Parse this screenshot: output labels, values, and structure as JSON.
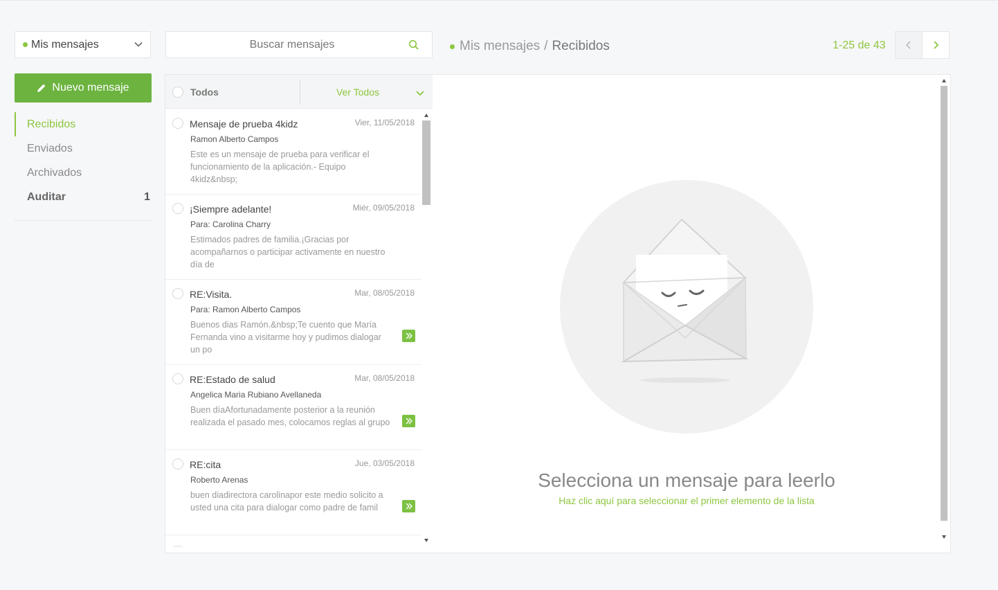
{
  "mailbox_select": {
    "label": "Mis mensajes"
  },
  "new_message": {
    "label": "Nuevo mensaje"
  },
  "folders": [
    {
      "label": "Recibidos",
      "count": ""
    },
    {
      "label": "Enviados",
      "count": ""
    },
    {
      "label": "Archivados",
      "count": ""
    },
    {
      "label": "Auditar",
      "count": "1"
    }
  ],
  "search": {
    "placeholder": "Buscar mensajes"
  },
  "breadcrumb": {
    "root": "Mis mensajes",
    "separator": "/",
    "current": "Recibidos"
  },
  "pagination": {
    "text": "1-25 de 43"
  },
  "list_header": {
    "select_all": "Todos",
    "filter": "Ver Todos"
  },
  "messages": [
    {
      "subject": "Mensaje de prueba 4kidz",
      "date": "Vier, 11/05/2018",
      "from": "Ramon Alberto Campos",
      "preview": "Este es un mensaje de prueba para verificar el funcionamiento de la aplicación.- Equipo 4kidz&nbsp;",
      "forwarded": false
    },
    {
      "subject": "¡Siempre adelante!",
      "date": "Miér, 09/05/2018",
      "from": "Para: Carolina Charry",
      "preview": "Estimados padres de familia.¡Gracias por acompañarnos o participar activamente en nuestro día de",
      "forwarded": false
    },
    {
      "subject": "RE:Visita.",
      "date": "Mar, 08/05/2018",
      "from": "Para: Ramon Alberto Campos",
      "preview": "Buenos dias Ramón.&nbsp;Te cuento que María Fernanda vino a visitarme hoy y pudimos dialogar un po",
      "forwarded": true
    },
    {
      "subject": "RE:Estado de salud",
      "date": "Mar, 08/05/2018",
      "from": "Angelica Maria Rubiano Avellaneda",
      "preview": "Buen díaAfortunadamente posterior a la reunión realizada el pasado mes, colocamos reglas al grupo",
      "forwarded": true
    },
    {
      "subject": "RE:cita",
      "date": "Jue, 03/05/2018",
      "from": "Roberto Arenas",
      "preview": "buen diadirectora carolinapor este medio solicito a usted una cita para dialogar como padre de famil",
      "forwarded": true
    }
  ],
  "empty_state": {
    "title": "Selecciona un mensaje para leerlo",
    "link": "Haz clic aquí para seleccionar el primer elemento de la lista"
  },
  "colors": {
    "accent": "#8dc63f",
    "button": "#6cb33f"
  },
  "icons": [
    "chevron-down-icon",
    "pencil-icon",
    "search-icon",
    "chevron-left-icon",
    "chevron-right-icon",
    "forward-icon",
    "envelope-illustration"
  ]
}
